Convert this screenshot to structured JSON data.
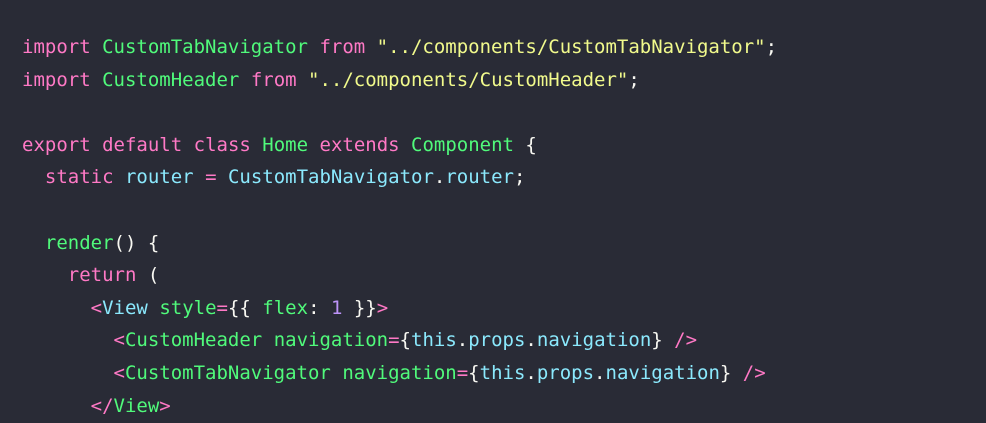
{
  "colors": {
    "background": "#292b36",
    "keyword": "#ff79c6",
    "class_name": "#50fa7b",
    "string": "#f1fa8c",
    "plain": "#f8f8f2",
    "property": "#8be9fd",
    "number": "#bd93f9"
  },
  "lines": [
    [
      {
        "t": "import",
        "c": "kw"
      },
      {
        "t": " ",
        "c": "pun"
      },
      {
        "t": "CustomTabNavigator",
        "c": "cls"
      },
      {
        "t": " ",
        "c": "pun"
      },
      {
        "t": "from",
        "c": "kw"
      },
      {
        "t": " ",
        "c": "pun"
      },
      {
        "t": "\"../components/CustomTabNavigator\"",
        "c": "str"
      },
      {
        "t": ";",
        "c": "pun"
      }
    ],
    [
      {
        "t": "import",
        "c": "kw"
      },
      {
        "t": " ",
        "c": "pun"
      },
      {
        "t": "CustomHeader",
        "c": "cls"
      },
      {
        "t": " ",
        "c": "pun"
      },
      {
        "t": "from",
        "c": "kw"
      },
      {
        "t": " ",
        "c": "pun"
      },
      {
        "t": "\"../components/CustomHeader\"",
        "c": "str"
      },
      {
        "t": ";",
        "c": "pun"
      }
    ],
    [],
    [
      {
        "t": "export",
        "c": "kw"
      },
      {
        "t": " ",
        "c": "pun"
      },
      {
        "t": "default",
        "c": "kw"
      },
      {
        "t": " ",
        "c": "pun"
      },
      {
        "t": "class",
        "c": "kw"
      },
      {
        "t": " ",
        "c": "pun"
      },
      {
        "t": "Home",
        "c": "cls"
      },
      {
        "t": " ",
        "c": "pun"
      },
      {
        "t": "extends",
        "c": "kw"
      },
      {
        "t": " ",
        "c": "pun"
      },
      {
        "t": "Component",
        "c": "cls"
      },
      {
        "t": " {",
        "c": "pun"
      }
    ],
    [
      {
        "t": "  ",
        "c": "pun"
      },
      {
        "t": "static",
        "c": "kw"
      },
      {
        "t": " ",
        "c": "pun"
      },
      {
        "t": "router",
        "c": "prop"
      },
      {
        "t": " ",
        "c": "pun"
      },
      {
        "t": "=",
        "c": "kw"
      },
      {
        "t": " ",
        "c": "pun"
      },
      {
        "t": "CustomTabNavigator",
        "c": "prop"
      },
      {
        "t": ".",
        "c": "pun"
      },
      {
        "t": "router",
        "c": "prop"
      },
      {
        "t": ";",
        "c": "pun"
      }
    ],
    [],
    [
      {
        "t": "  ",
        "c": "pun"
      },
      {
        "t": "render",
        "c": "cls"
      },
      {
        "t": "() {",
        "c": "pun"
      }
    ],
    [
      {
        "t": "    ",
        "c": "pun"
      },
      {
        "t": "return",
        "c": "kw"
      },
      {
        "t": " (",
        "c": "pun"
      }
    ],
    [
      {
        "t": "      ",
        "c": "pun"
      },
      {
        "t": "<",
        "c": "kw"
      },
      {
        "t": "View",
        "c": "prop"
      },
      {
        "t": " ",
        "c": "pun"
      },
      {
        "t": "style",
        "c": "cls"
      },
      {
        "t": "=",
        "c": "kw"
      },
      {
        "t": "{{ ",
        "c": "pun"
      },
      {
        "t": "flex",
        "c": "cls"
      },
      {
        "t": ": ",
        "c": "pun"
      },
      {
        "t": "1",
        "c": "num"
      },
      {
        "t": " }}",
        "c": "pun"
      },
      {
        "t": ">",
        "c": "kw"
      }
    ],
    [
      {
        "t": "        ",
        "c": "pun"
      },
      {
        "t": "<",
        "c": "kw"
      },
      {
        "t": "CustomHeader",
        "c": "cls"
      },
      {
        "t": " ",
        "c": "pun"
      },
      {
        "t": "navigation",
        "c": "cls"
      },
      {
        "t": "=",
        "c": "kw"
      },
      {
        "t": "{",
        "c": "pun"
      },
      {
        "t": "this",
        "c": "prop"
      },
      {
        "t": ".",
        "c": "pun"
      },
      {
        "t": "props",
        "c": "prop"
      },
      {
        "t": ".",
        "c": "pun"
      },
      {
        "t": "navigation",
        "c": "prop"
      },
      {
        "t": "}",
        "c": "pun"
      },
      {
        "t": " ",
        "c": "pun"
      },
      {
        "t": "/>",
        "c": "kw"
      }
    ],
    [
      {
        "t": "        ",
        "c": "pun"
      },
      {
        "t": "<",
        "c": "kw"
      },
      {
        "t": "CustomTabNavigator",
        "c": "cls"
      },
      {
        "t": " ",
        "c": "pun"
      },
      {
        "t": "navigation",
        "c": "cls"
      },
      {
        "t": "=",
        "c": "kw"
      },
      {
        "t": "{",
        "c": "pun"
      },
      {
        "t": "this",
        "c": "prop"
      },
      {
        "t": ".",
        "c": "pun"
      },
      {
        "t": "props",
        "c": "prop"
      },
      {
        "t": ".",
        "c": "pun"
      },
      {
        "t": "navigation",
        "c": "prop"
      },
      {
        "t": "}",
        "c": "pun"
      },
      {
        "t": " ",
        "c": "pun"
      },
      {
        "t": "/>",
        "c": "kw"
      }
    ],
    [
      {
        "t": "      ",
        "c": "pun"
      },
      {
        "t": "</",
        "c": "kw"
      },
      {
        "t": "View",
        "c": "cls"
      },
      {
        "t": ">",
        "c": "kw"
      }
    ]
  ]
}
